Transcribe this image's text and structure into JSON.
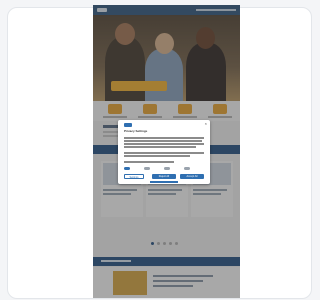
{
  "cookie_modal": {
    "title": "Privacy Settings",
    "buttons": {
      "settings": "Settings",
      "reject": "Reject All",
      "accept": "Accept All"
    },
    "close_glyph": "×"
  },
  "colors": {
    "brand_blue": "#2f5a88",
    "accent_orange": "#e7a63a",
    "modal_button_blue": "#2f6fb1"
  }
}
